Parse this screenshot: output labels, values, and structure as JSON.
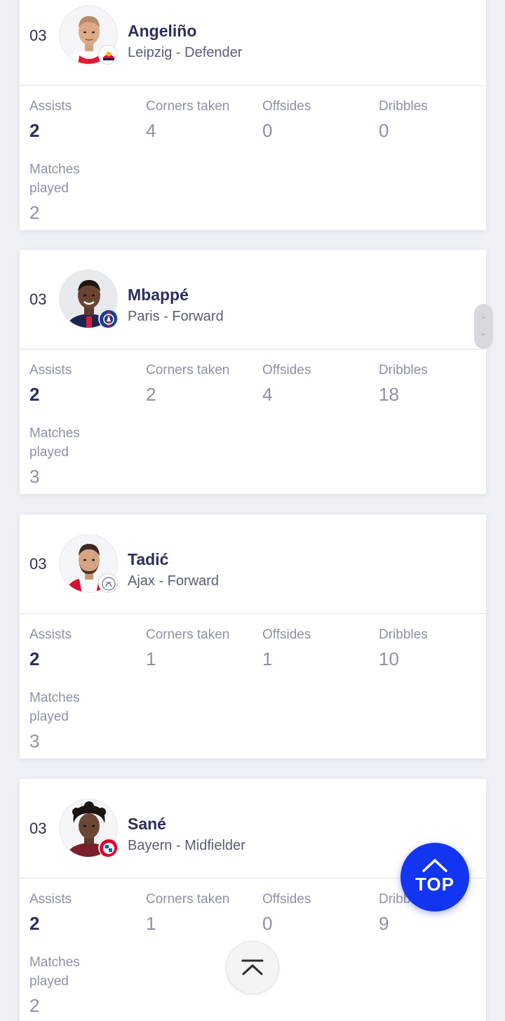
{
  "players": [
    {
      "rank": "03",
      "name": "Angeliño",
      "team_position": "Leipzig - Defender",
      "stats": {
        "assists": {
          "label": "Assists",
          "value": "2"
        },
        "corners": {
          "label": "Corners taken",
          "value": "4"
        },
        "offsides": {
          "label": "Offsides",
          "value": "0"
        },
        "dribbles": {
          "label": "Dribbles",
          "value": "0"
        },
        "matches": {
          "label": "Matches played",
          "value": "2"
        }
      },
      "avatar_icon": "player-portrait-icon",
      "club_icon": "rb-leipzig-crest-icon"
    },
    {
      "rank": "03",
      "name": "Mbappé",
      "team_position": "Paris - Forward",
      "stats": {
        "assists": {
          "label": "Assists",
          "value": "2"
        },
        "corners": {
          "label": "Corners taken",
          "value": "2"
        },
        "offsides": {
          "label": "Offsides",
          "value": "4"
        },
        "dribbles": {
          "label": "Dribbles",
          "value": "18"
        },
        "matches": {
          "label": "Matches played",
          "value": "3"
        }
      },
      "avatar_icon": "player-portrait-icon",
      "club_icon": "psg-crest-icon"
    },
    {
      "rank": "03",
      "name": "Tadić",
      "team_position": "Ajax - Forward",
      "stats": {
        "assists": {
          "label": "Assists",
          "value": "2"
        },
        "corners": {
          "label": "Corners taken",
          "value": "1"
        },
        "offsides": {
          "label": "Offsides",
          "value": "1"
        },
        "dribbles": {
          "label": "Dribbles",
          "value": "10"
        },
        "matches": {
          "label": "Matches played",
          "value": "3"
        }
      },
      "avatar_icon": "player-portrait-icon",
      "club_icon": "ajax-crest-icon"
    },
    {
      "rank": "03",
      "name": "Sané",
      "team_position": "Bayern - Midfielder",
      "stats": {
        "assists": {
          "label": "Assists",
          "value": "2"
        },
        "corners": {
          "label": "Corners taken",
          "value": "1"
        },
        "offsides": {
          "label": "Offsides",
          "value": "0"
        },
        "dribbles": {
          "label": "Dribbles",
          "value": "9"
        },
        "matches": {
          "label": "Matches played",
          "value": "2"
        }
      },
      "avatar_icon": "player-portrait-icon",
      "club_icon": "bayern-crest-icon"
    }
  ],
  "top_button": {
    "label": "TOP",
    "icon": "chevron-up-icon"
  },
  "scroll_top_icon": "scroll-to-top-icon",
  "colors": {
    "accent": "#1334f0",
    "text_dark": "#2d2f5a",
    "text_muted": "#8e91a5",
    "background": "#eef0f5"
  }
}
